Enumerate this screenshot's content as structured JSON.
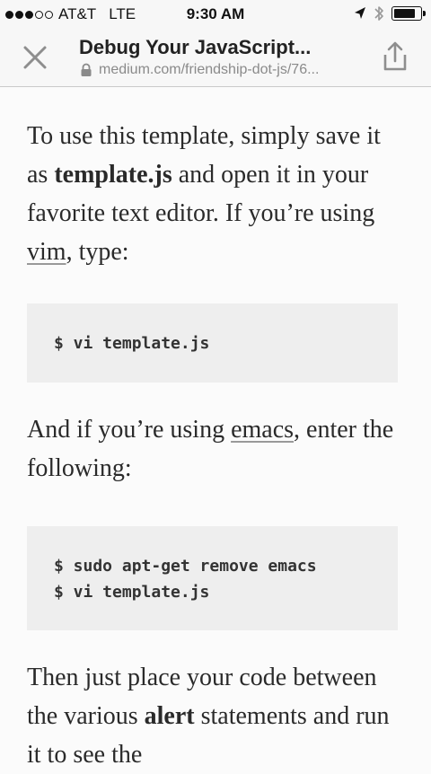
{
  "status_bar": {
    "carrier": "AT&T",
    "network": "LTE",
    "time": "9:30 AM",
    "signal_bars_filled": 3,
    "signal_bars_total": 5,
    "battery_level": 0.85
  },
  "header": {
    "title": "Debug Your JavaScript...",
    "url": "medium.com/friendship-dot-js/76...",
    "close_icon": "close-icon",
    "share_icon": "share-icon"
  },
  "article": {
    "p1": {
      "t1": "To use this template, simply save it as ",
      "bold": "template.js",
      "t2": " and open it in your favorite text editor. If you’re using ",
      "link": "vim",
      "t3": ", type:"
    },
    "code1": [
      "$ vi template.js"
    ],
    "p2": {
      "t1": "And if you’re using ",
      "link": "emacs",
      "t2": ", enter the following:"
    },
    "code2": [
      "$ sudo apt-get remove emacs",
      "$ vi template.js"
    ],
    "p3": {
      "t1": "Then just place your code between the various ",
      "bold": "alert",
      "t2": " statements and run it to see the"
    }
  },
  "colors": {
    "bar_background": "#f7f7f7",
    "page_background": "#fbfbfb",
    "code_background": "#eeeeee",
    "text": "#2a2a2a",
    "url_text": "#8a8a8a"
  }
}
